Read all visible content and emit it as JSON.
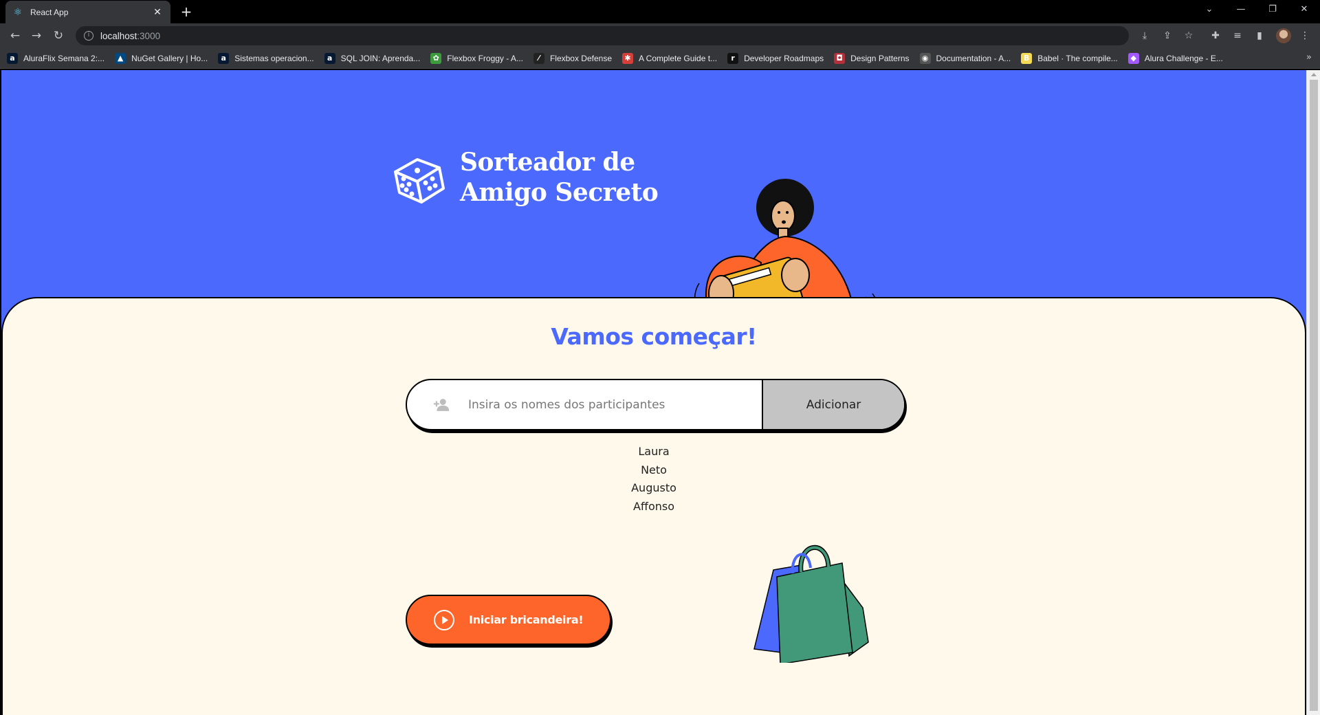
{
  "browser": {
    "tab_title": "React App",
    "tab_close": "✕",
    "new_tab": "+",
    "url_host": "localhost",
    "url_port": ":3000",
    "window_controls": [
      "⌄",
      "—",
      "❐",
      "✕"
    ],
    "nav_icons": [
      "back-icon",
      "forward-icon",
      "reload-icon"
    ],
    "bookmarks": [
      {
        "label": "AluraFlix Semana 2:...",
        "icon": "a",
        "color": "#051933"
      },
      {
        "label": "NuGet Gallery | Ho...",
        "icon": "▲",
        "color": "#004880"
      },
      {
        "label": "Sistemas operacion...",
        "icon": "a",
        "color": "#051933"
      },
      {
        "label": "SQL JOIN: Aprenda...",
        "icon": "a",
        "color": "#051933"
      },
      {
        "label": "Flexbox Froggy - A...",
        "icon": "✿",
        "color": "#3c9b3c"
      },
      {
        "label": "Flexbox Defense",
        "icon": "⁄",
        "color": "#222"
      },
      {
        "label": "A Complete Guide t...",
        "icon": "✱",
        "color": "#d43f3a"
      },
      {
        "label": "Developer Roadmaps",
        "icon": "r",
        "color": "#111"
      },
      {
        "label": "Design Patterns",
        "icon": "◘",
        "color": "#b3303a"
      },
      {
        "label": "Documentation - A...",
        "icon": "◉",
        "color": "#555"
      },
      {
        "label": "Babel · The compile...",
        "icon": "B",
        "color": "#f5da55"
      },
      {
        "label": "Alura Challenge - E...",
        "icon": "◆",
        "color": "#a259ff"
      }
    ],
    "bookmarks_more": "»"
  },
  "app": {
    "logo_line1": "Sorteador de",
    "logo_line2": "Amigo Secreto",
    "heading": "Vamos começar!",
    "input_placeholder": "Insira os nomes dos participantes",
    "add_button": "Adicionar",
    "participants": [
      "Laura",
      "Neto",
      "Augusto",
      "Affonso"
    ],
    "start_button": "Iniciar bricandeira!",
    "colors": {
      "header_blue": "#4b69fd",
      "card_cream": "#fff9eb",
      "orange": "#fe652b",
      "button_gray": "#c4c4c4",
      "bag_green": "#41997a"
    }
  }
}
